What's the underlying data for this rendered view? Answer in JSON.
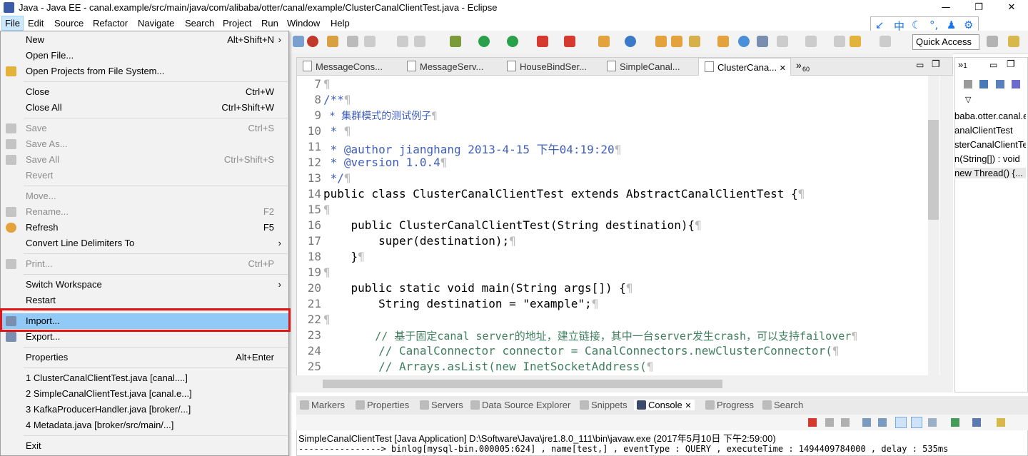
{
  "window": {
    "title": "Java - Java EE - canal.example/src/main/java/com/alibaba/otter/canal/example/ClusterCanalClientTest.java - Eclipse",
    "controls": [
      "—",
      "❐",
      "✕"
    ]
  },
  "menubar": [
    "File",
    "Edit",
    "Source",
    "Refactor",
    "Navigate",
    "Search",
    "Project",
    "Run",
    "Window",
    "Help"
  ],
  "ime": {
    "items": [
      "↙",
      "中",
      "☾",
      "°,",
      "♟",
      "⚙"
    ]
  },
  "toolbar": {
    "quick_access": "Quick Access"
  },
  "file_menu": {
    "items": [
      {
        "label": "New",
        "shortcut": "Alt+Shift+N",
        "submenu": true
      },
      {
        "label": "Open File...",
        "shortcut": ""
      },
      {
        "label": "Open Projects from File System...",
        "shortcut": ""
      },
      {
        "label": "Close",
        "shortcut": "Ctrl+W"
      },
      {
        "label": "Close All",
        "shortcut": "Ctrl+Shift+W"
      },
      {
        "label": "Save",
        "shortcut": "Ctrl+S",
        "disabled": true
      },
      {
        "label": "Save As...",
        "shortcut": "",
        "disabled": true
      },
      {
        "label": "Save All",
        "shortcut": "Ctrl+Shift+S",
        "disabled": true
      },
      {
        "label": "Revert",
        "shortcut": "",
        "disabled": true
      },
      {
        "label": "Move...",
        "shortcut": "",
        "disabled": true
      },
      {
        "label": "Rename...",
        "shortcut": "F2",
        "disabled": true
      },
      {
        "label": "Refresh",
        "shortcut": "F5"
      },
      {
        "label": "Convert Line Delimiters To",
        "shortcut": "",
        "submenu": true
      },
      {
        "label": "Print...",
        "shortcut": "Ctrl+P",
        "disabled": true
      },
      {
        "label": "Switch Workspace",
        "shortcut": "",
        "submenu": true
      },
      {
        "label": "Restart",
        "shortcut": ""
      },
      {
        "label": "Import...",
        "shortcut": "",
        "highlighted": true
      },
      {
        "label": "Export...",
        "shortcut": ""
      },
      {
        "label": "Properties",
        "shortcut": "Alt+Enter"
      },
      {
        "label": "1 ClusterCanalClientTest.java  [canal....]",
        "shortcut": ""
      },
      {
        "label": "2 SimpleCanalClientTest.java  [canal.e...]",
        "shortcut": ""
      },
      {
        "label": "3 KafkaProducerHandler.java  [broker/...]",
        "shortcut": ""
      },
      {
        "label": "4 Metadata.java  [broker/src/main/...]",
        "shortcut": ""
      },
      {
        "label": "Exit",
        "shortcut": ""
      }
    ]
  },
  "editor_tabs": [
    {
      "label": "MessageCons..."
    },
    {
      "label": "MessageServ..."
    },
    {
      "label": "HouseBindSer..."
    },
    {
      "label": "SimpleCanal..."
    },
    {
      "label": "ClusterCana...",
      "active": true,
      "close": "✕"
    }
  ],
  "editor_overflow": {
    "symbol": "»",
    "count": "60"
  },
  "code_lines": [
    {
      "n": "7",
      "text": ""
    },
    {
      "n": "8",
      "text": "/**"
    },
    {
      "n": "9",
      "text": " * 集群模式的测试例子"
    },
    {
      "n": "10",
      "text": " * "
    },
    {
      "n": "11",
      "text": " * @author jianghang 2013-4-15 下午04:19:20"
    },
    {
      "n": "12",
      "text": " * @version 1.0.4"
    },
    {
      "n": "13",
      "text": " */"
    },
    {
      "n": "14",
      "text": "public class ClusterCanalClientTest extends AbstractCanalClientTest {"
    },
    {
      "n": "15",
      "text": ""
    },
    {
      "n": "16",
      "text": "    public ClusterCanalClientTest(String destination){"
    },
    {
      "n": "17",
      "text": "        super(destination);"
    },
    {
      "n": "18",
      "text": "    }"
    },
    {
      "n": "19",
      "text": ""
    },
    {
      "n": "20",
      "text": "    public static void main(String args[]) {"
    },
    {
      "n": "21",
      "text": "        String destination = \"example\";"
    },
    {
      "n": "22",
      "text": ""
    },
    {
      "n": "23",
      "text": "        // 基于固定canal server的地址，建立链接，其中一台server发生crash，可以支持failover"
    },
    {
      "n": "24",
      "text": "        // CanalConnector connector = CanalConnectors.newClusterConnector("
    },
    {
      "n": "25",
      "text": "        // Arrays.asList(new InetSocketAddress("
    }
  ],
  "outline": {
    "top_label": "1",
    "items": [
      "baba.otter.canal.e",
      "analClientTest",
      "sterCanalClientTe",
      "n(String[]) : void",
      "new Thread() {..."
    ]
  },
  "bottom_tabs": [
    {
      "label": "Markers"
    },
    {
      "label": "Properties"
    },
    {
      "label": "Servers"
    },
    {
      "label": "Data Source Explorer"
    },
    {
      "label": "Snippets"
    },
    {
      "label": "Console",
      "active": true,
      "close": "✕"
    },
    {
      "label": "Progress"
    },
    {
      "label": "Search"
    }
  ],
  "console": {
    "header": "SimpleCanalClientTest [Java Application] D:\\Software\\Java\\jre1.8.0_111\\bin\\javaw.exe (2017年5月10日 下午2:59:00)",
    "line": "----------------> binlog[mysql-bin.000005:624] , name[test,] , eventType : QUERY , executeTime : 1494409784000 , delay : 535ms"
  },
  "colors": {
    "highlight": "#91c9f7",
    "red_box": "#e11414",
    "keyword": "#7f0055",
    "comment": "#3f7f5f",
    "javadoc": "#3f5fbf",
    "string": "#2a00ff"
  }
}
